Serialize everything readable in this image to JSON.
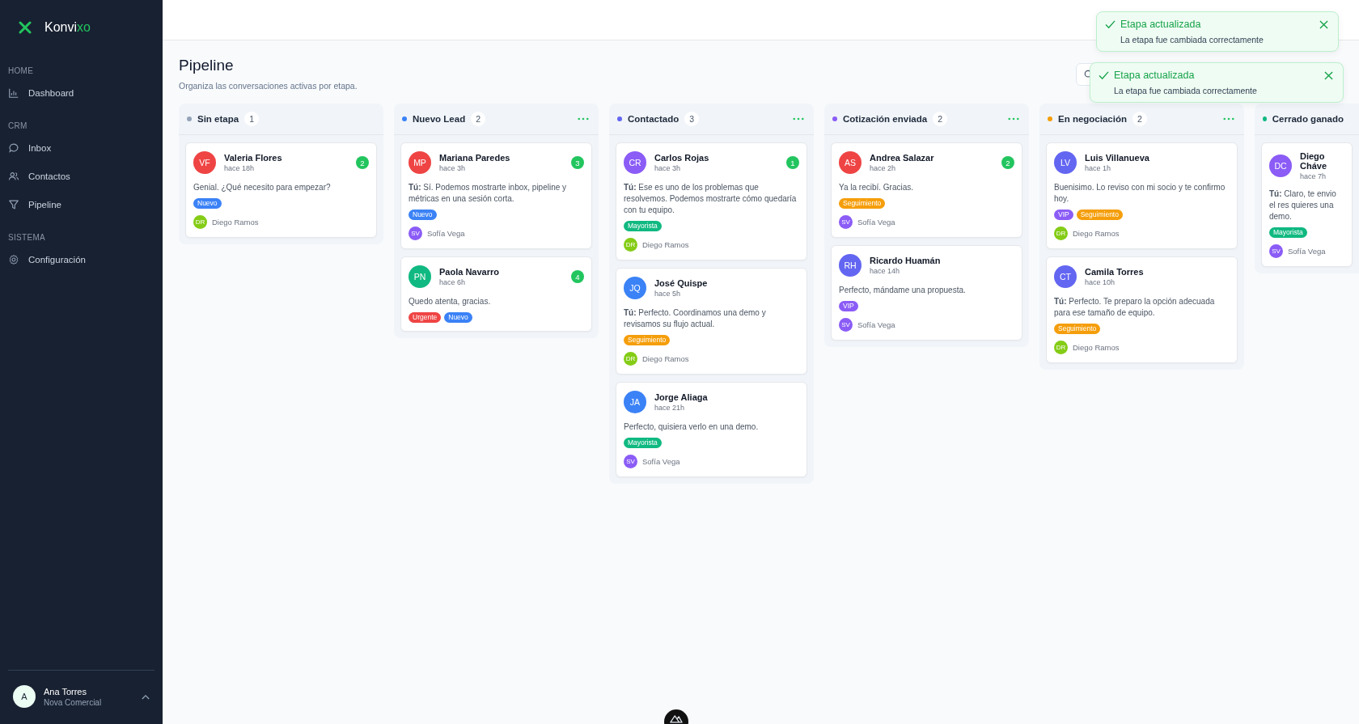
{
  "brand": {
    "name_main": "Konvi",
    "name_accent": "xo"
  },
  "sidebar": {
    "sections": [
      {
        "title": "HOME",
        "items": [
          {
            "label": "Dashboard",
            "kind": "chart"
          }
        ]
      },
      {
        "title": "CRM",
        "items": [
          {
            "label": "Inbox",
            "kind": "chat"
          },
          {
            "label": "Contactos",
            "kind": "users"
          },
          {
            "label": "Pipeline",
            "kind": "funnel"
          }
        ]
      },
      {
        "title": "SISTEMA",
        "items": [
          {
            "label": "Configuración",
            "kind": "gear"
          }
        ]
      }
    ],
    "user": {
      "initial": "A",
      "name": "Ana Torres",
      "org": "Nova Comercial"
    }
  },
  "page": {
    "title": "Pipeline",
    "subtitle": "Organiza las conversaciones activas por etapa."
  },
  "columns": [
    {
      "name": "Sin etapa",
      "count": "1",
      "color": "#94a3b8",
      "menu": false,
      "cards": [
        {
          "initials": "VF",
          "color": "#ef4444",
          "name": "Valeria Flores",
          "time": "hace 18h",
          "unread": "2",
          "message": "Genial. ¿Qué necesito para empezar?",
          "tags": [
            {
              "label": "Nuevo",
              "color": "#3b82f6"
            }
          ],
          "agent": {
            "initials": "DR",
            "name": "Diego Ramos",
            "color": "#84cc16"
          }
        }
      ]
    },
    {
      "name": "Nuevo Lead",
      "count": "2",
      "color": "#3b82f6",
      "menu": true,
      "cards": [
        {
          "initials": "MP",
          "color": "#ef4444",
          "name": "Mariana Paredes",
          "time": "hace 3h",
          "unread": "3",
          "message": "**Tú:** Sí. Podemos mostrarte inbox, pipeline y métricas en una sesión corta.",
          "tags": [
            {
              "label": "Nuevo",
              "color": "#3b82f6"
            }
          ],
          "agent": {
            "initials": "SV",
            "name": "Sofía Vega",
            "color": "#8b5cf6"
          }
        },
        {
          "initials": "PN",
          "color": "#10b981",
          "name": "Paola Navarro",
          "time": "hace 6h",
          "unread": "4",
          "message": "Quedo atenta, gracias.",
          "tags": [
            {
              "label": "Urgente",
              "color": "#ef4444"
            },
            {
              "label": "Nuevo",
              "color": "#3b82f6"
            }
          ]
        }
      ]
    },
    {
      "name": "Contactado",
      "count": "3",
      "color": "#6366f1",
      "menu": true,
      "cards": [
        {
          "initials": "CR",
          "color": "#8b5cf6",
          "name": "Carlos Rojas",
          "time": "hace 3h",
          "unread": "1",
          "message": "**Tú:** Ese es uno de los problemas que resolvemos. Podemos mostrarte cómo quedaría con tu equipo.",
          "tags": [
            {
              "label": "Mayorista",
              "color": "#10b981"
            }
          ],
          "agent": {
            "initials": "DR",
            "name": "Diego Ramos",
            "color": "#84cc16"
          }
        },
        {
          "initials": "JQ",
          "color": "#3b82f6",
          "name": "José Quispe",
          "time": "hace 5h",
          "message": "**Tú:** Perfecto. Coordinamos una demo y revisamos su flujo actual.",
          "tags": [
            {
              "label": "Seguimiento",
              "color": "#f59e0b"
            }
          ],
          "agent": {
            "initials": "DR",
            "name": "Diego Ramos",
            "color": "#84cc16"
          }
        },
        {
          "initials": "JA",
          "color": "#3b82f6",
          "name": "Jorge Aliaga",
          "time": "hace 21h",
          "message": "Perfecto, quisiera verlo en una demo.",
          "tags": [
            {
              "label": "Mayorista",
              "color": "#10b981"
            }
          ],
          "agent": {
            "initials": "SV",
            "name": "Sofía Vega",
            "color": "#8b5cf6"
          }
        }
      ]
    },
    {
      "name": "Cotización enviada",
      "count": "2",
      "color": "#8b5cf6",
      "menu": true,
      "cards": [
        {
          "initials": "AS",
          "color": "#ef4444",
          "name": "Andrea Salazar",
          "time": "hace 2h",
          "unread": "2",
          "message": "Ya la recibí. Gracias.",
          "tags": [
            {
              "label": "Seguimiento",
              "color": "#f59e0b"
            }
          ],
          "agent": {
            "initials": "SV",
            "name": "Sofía Vega",
            "color": "#8b5cf6"
          }
        },
        {
          "initials": "RH",
          "color": "#6366f1",
          "name": "Ricardo Huamán",
          "time": "hace 14h",
          "message": "Perfecto, mándame una propuesta.",
          "tags": [
            {
              "label": "VIP",
              "color": "#8b5cf6"
            }
          ],
          "agent": {
            "initials": "SV",
            "name": "Sofía Vega",
            "color": "#8b5cf6"
          }
        }
      ]
    },
    {
      "name": "En negociación",
      "count": "2",
      "color": "#f59e0b",
      "menu": true,
      "cards": [
        {
          "initials": "LV",
          "color": "#6366f1",
          "name": "Luis Villanueva",
          "time": "hace 1h",
          "message": "Buenisimo. Lo reviso con mi socio y te confirmo hoy.",
          "tags": [
            {
              "label": "VIP",
              "color": "#8b5cf6"
            },
            {
              "label": "Seguimiento",
              "color": "#f59e0b"
            }
          ],
          "agent": {
            "initials": "DR",
            "name": "Diego Ramos",
            "color": "#84cc16"
          }
        },
        {
          "initials": "CT",
          "color": "#6366f1",
          "name": "Camila Torres",
          "time": "hace 10h",
          "message": "**Tú:** Perfecto. Te preparo la opción adecuada para ese tamaño de equipo.",
          "tags": [
            {
              "label": "Seguimiento",
              "color": "#f59e0b"
            }
          ],
          "agent": {
            "initials": "DR",
            "name": "Diego Ramos",
            "color": "#84cc16"
          }
        }
      ]
    },
    {
      "name": "Cerrado ganado",
      "color": "#10b981",
      "menu": false,
      "cards": [
        {
          "initials": "DC",
          "color": "#8b5cf6",
          "name": "Diego Cháve",
          "time": "hace 7h",
          "message": "**Tú:** Claro, te envio el res quieres una demo.",
          "tags": [
            {
              "label": "Mayorista",
              "color": "#10b981"
            }
          ],
          "agent": {
            "initials": "SV",
            "name": "Sofía Vega",
            "color": "#8b5cf6"
          }
        }
      ]
    }
  ],
  "toasts": [
    {
      "title": "Etapa actualizada",
      "message": "La etapa fue cambiada correctamente"
    },
    {
      "title": "Etapa actualizada",
      "message": "La etapa fue cambiada correctamente"
    }
  ]
}
